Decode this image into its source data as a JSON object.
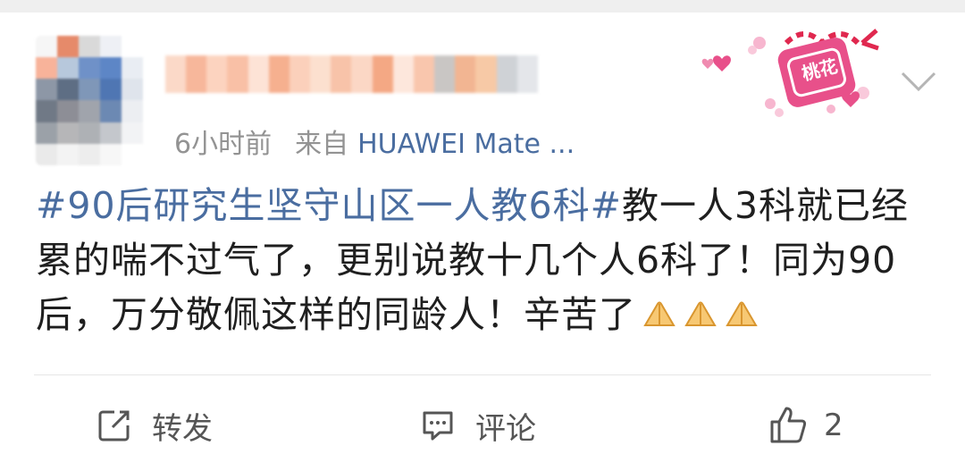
{
  "post": {
    "time": "6小时前",
    "source_prefix": "来自",
    "device": "HUAWEI Mate ...",
    "hashtag": "#90后研究生坚守山区一人教6科#",
    "text": "教一人3科就已经累的喘不过气了，更别说教十几个人6科了！同为90后，万分敬佩这样的同龄人！辛苦了",
    "badge_text": "桃花",
    "praise_emoji_count": 3
  },
  "actions": {
    "forward_label": "转发",
    "comment_label": "评论",
    "like_count": "2"
  },
  "colors": {
    "link": "#4a6da0",
    "meta": "#939393",
    "text": "#1f1f1f",
    "badge": "#e8508a"
  },
  "icons": [
    "forward-icon",
    "comment-icon",
    "like-icon",
    "chevron-down-icon",
    "peach-blossom-badge-icon",
    "praise-hands-icon"
  ]
}
